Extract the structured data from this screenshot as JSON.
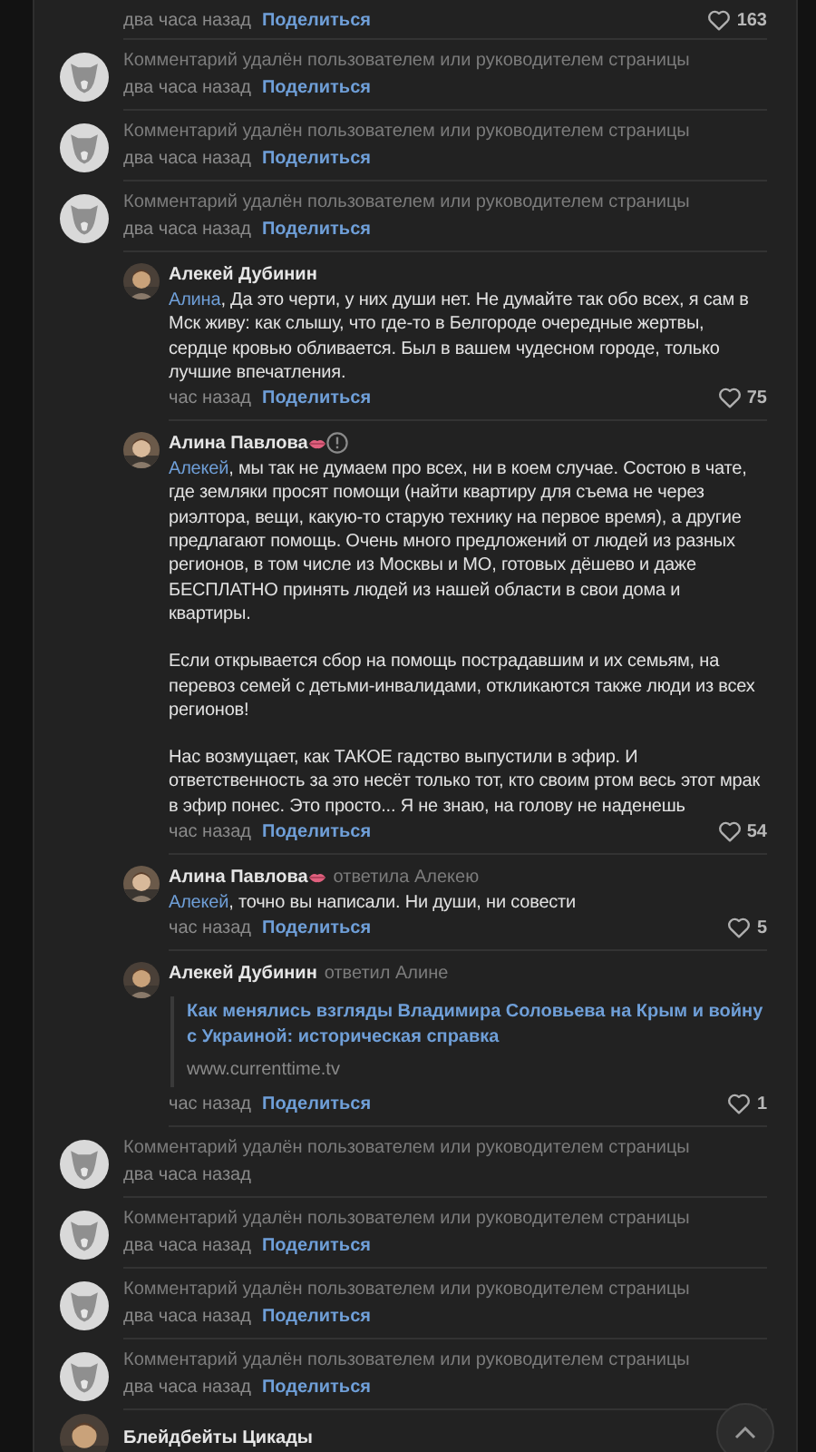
{
  "top_footer": {
    "time": "два часа назад",
    "share": "Поделиться",
    "likes": "163"
  },
  "comments": [
    {
      "kind": "deleted",
      "text": "Комментарий удалён пользователем или руководителем страницы",
      "time": "два часа назад",
      "share": "Поделиться"
    },
    {
      "kind": "deleted",
      "text": "Комментарий удалён пользователем или руководителем страницы",
      "time": "два часа назад",
      "share": "Поделиться"
    },
    {
      "kind": "deleted",
      "text": "Комментарий удалён пользователем или руководителем страницы",
      "time": "два часа назад",
      "share": "Поделиться"
    },
    {
      "kind": "reply",
      "author": "Алекей Дубинин",
      "mention": "Алина",
      "paragraphs": [
        ", Да это черти, у них души нет. Не думайте так обо всех, я сам в Мск живу: как слышу, что где-то в Белгороде очередные жертвы, сердце кровью обливается. Был в вашем чудесном городе, только лучшие впечатления."
      ],
      "time": "час назад",
      "share": "Поделиться",
      "likes": "75"
    },
    {
      "kind": "reply",
      "author": "Алина Павлова",
      "badge": true,
      "info": true,
      "mention": "Алекей",
      "paragraphs": [
        ", мы так не думаем про всех, ни в коем случае. Состою в чате, где земляки просят помощи (найти квартиру для съема не через риэлтора, вещи, какую-то старую технику на первое время), а другие предлагают помощь. Очень много предложений от людей из разных регионов, в том числе из Москвы и МО, готовых дёшево и даже БЕСПЛАТНО принять людей из нашей области в свои дома и квартиры.",
        "Если открывается сбор на помощь пострадавшим и их семьям, на перевоз семей с детьми-инвалидами, откликаются также люди из всех регионов!",
        "Нас возмущает, как ТАКОЕ гадство выпустили в эфир. И ответственность за это несёт только тот, кто своим ртом весь этот мрак в эфир понес. Это просто... Я не знаю, на голову не наденешь"
      ],
      "time": "час назад",
      "share": "Поделиться",
      "likes": "54"
    },
    {
      "kind": "reply",
      "author": "Алина Павлова",
      "badge": true,
      "replied_to": "ответила Алекею",
      "mention": "Алекей",
      "paragraphs": [
        ", точно вы написали. Ни души, ни совести"
      ],
      "time": "час назад",
      "share": "Поделиться",
      "likes": "5"
    },
    {
      "kind": "reply",
      "author": "Алекей Дубинин",
      "replied_to": "ответил Алине",
      "link": {
        "title": "Как менялись взгляды Владимира Соловьева на Крым и войну с Украиной: историческая справка",
        "url": "www.currenttime.tv"
      },
      "time": "час назад",
      "share": "Поделиться",
      "likes": "1"
    },
    {
      "kind": "deleted",
      "text": "Комментарий удалён пользователем или руководителем страницы",
      "time": "два часа назад"
    },
    {
      "kind": "deleted",
      "text": "Комментарий удалён пользователем или руководителем страницы",
      "time": "два часа назад",
      "share": "Поделиться"
    },
    {
      "kind": "deleted",
      "text": "Комментарий удалён пользователем или руководителем страницы",
      "time": "два часа назад",
      "share": "Поделиться"
    },
    {
      "kind": "deleted",
      "text": "Комментарий удалён пользователем или руководителем страницы",
      "time": "два часа назад",
      "share": "Поделиться"
    },
    {
      "kind": "top",
      "author": "Блейдбейты Цикады"
    }
  ]
}
